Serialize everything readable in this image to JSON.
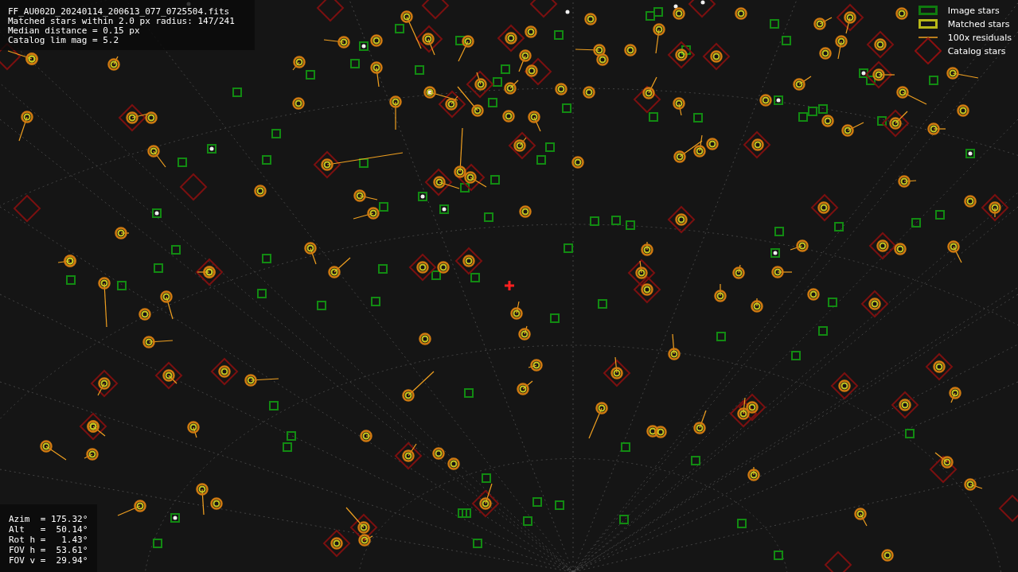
{
  "info_panel": {
    "lines": [
      "FF_AU002D_20240114_200613_077_0725504.fits",
      "Matched stars within 2.0 px radius: 147/241",
      "Median distance = 0.15 px",
      "Catalog lim mag = 5.2"
    ]
  },
  "pointing_panel": {
    "lines": [
      "Azim  = 175.32°",
      "Alt   =  50.14°",
      "Rot h =   1.43°",
      "FOV h =  53.61°",
      "FOV v =  29.94°"
    ]
  },
  "legend": [
    {
      "kind": "image",
      "label": "Image stars"
    },
    {
      "kind": "matched",
      "label": "Matched stars"
    },
    {
      "kind": "residual",
      "label": "100x residuals"
    },
    {
      "kind": "catalog",
      "label": "Catalog stars"
    }
  ]
}
